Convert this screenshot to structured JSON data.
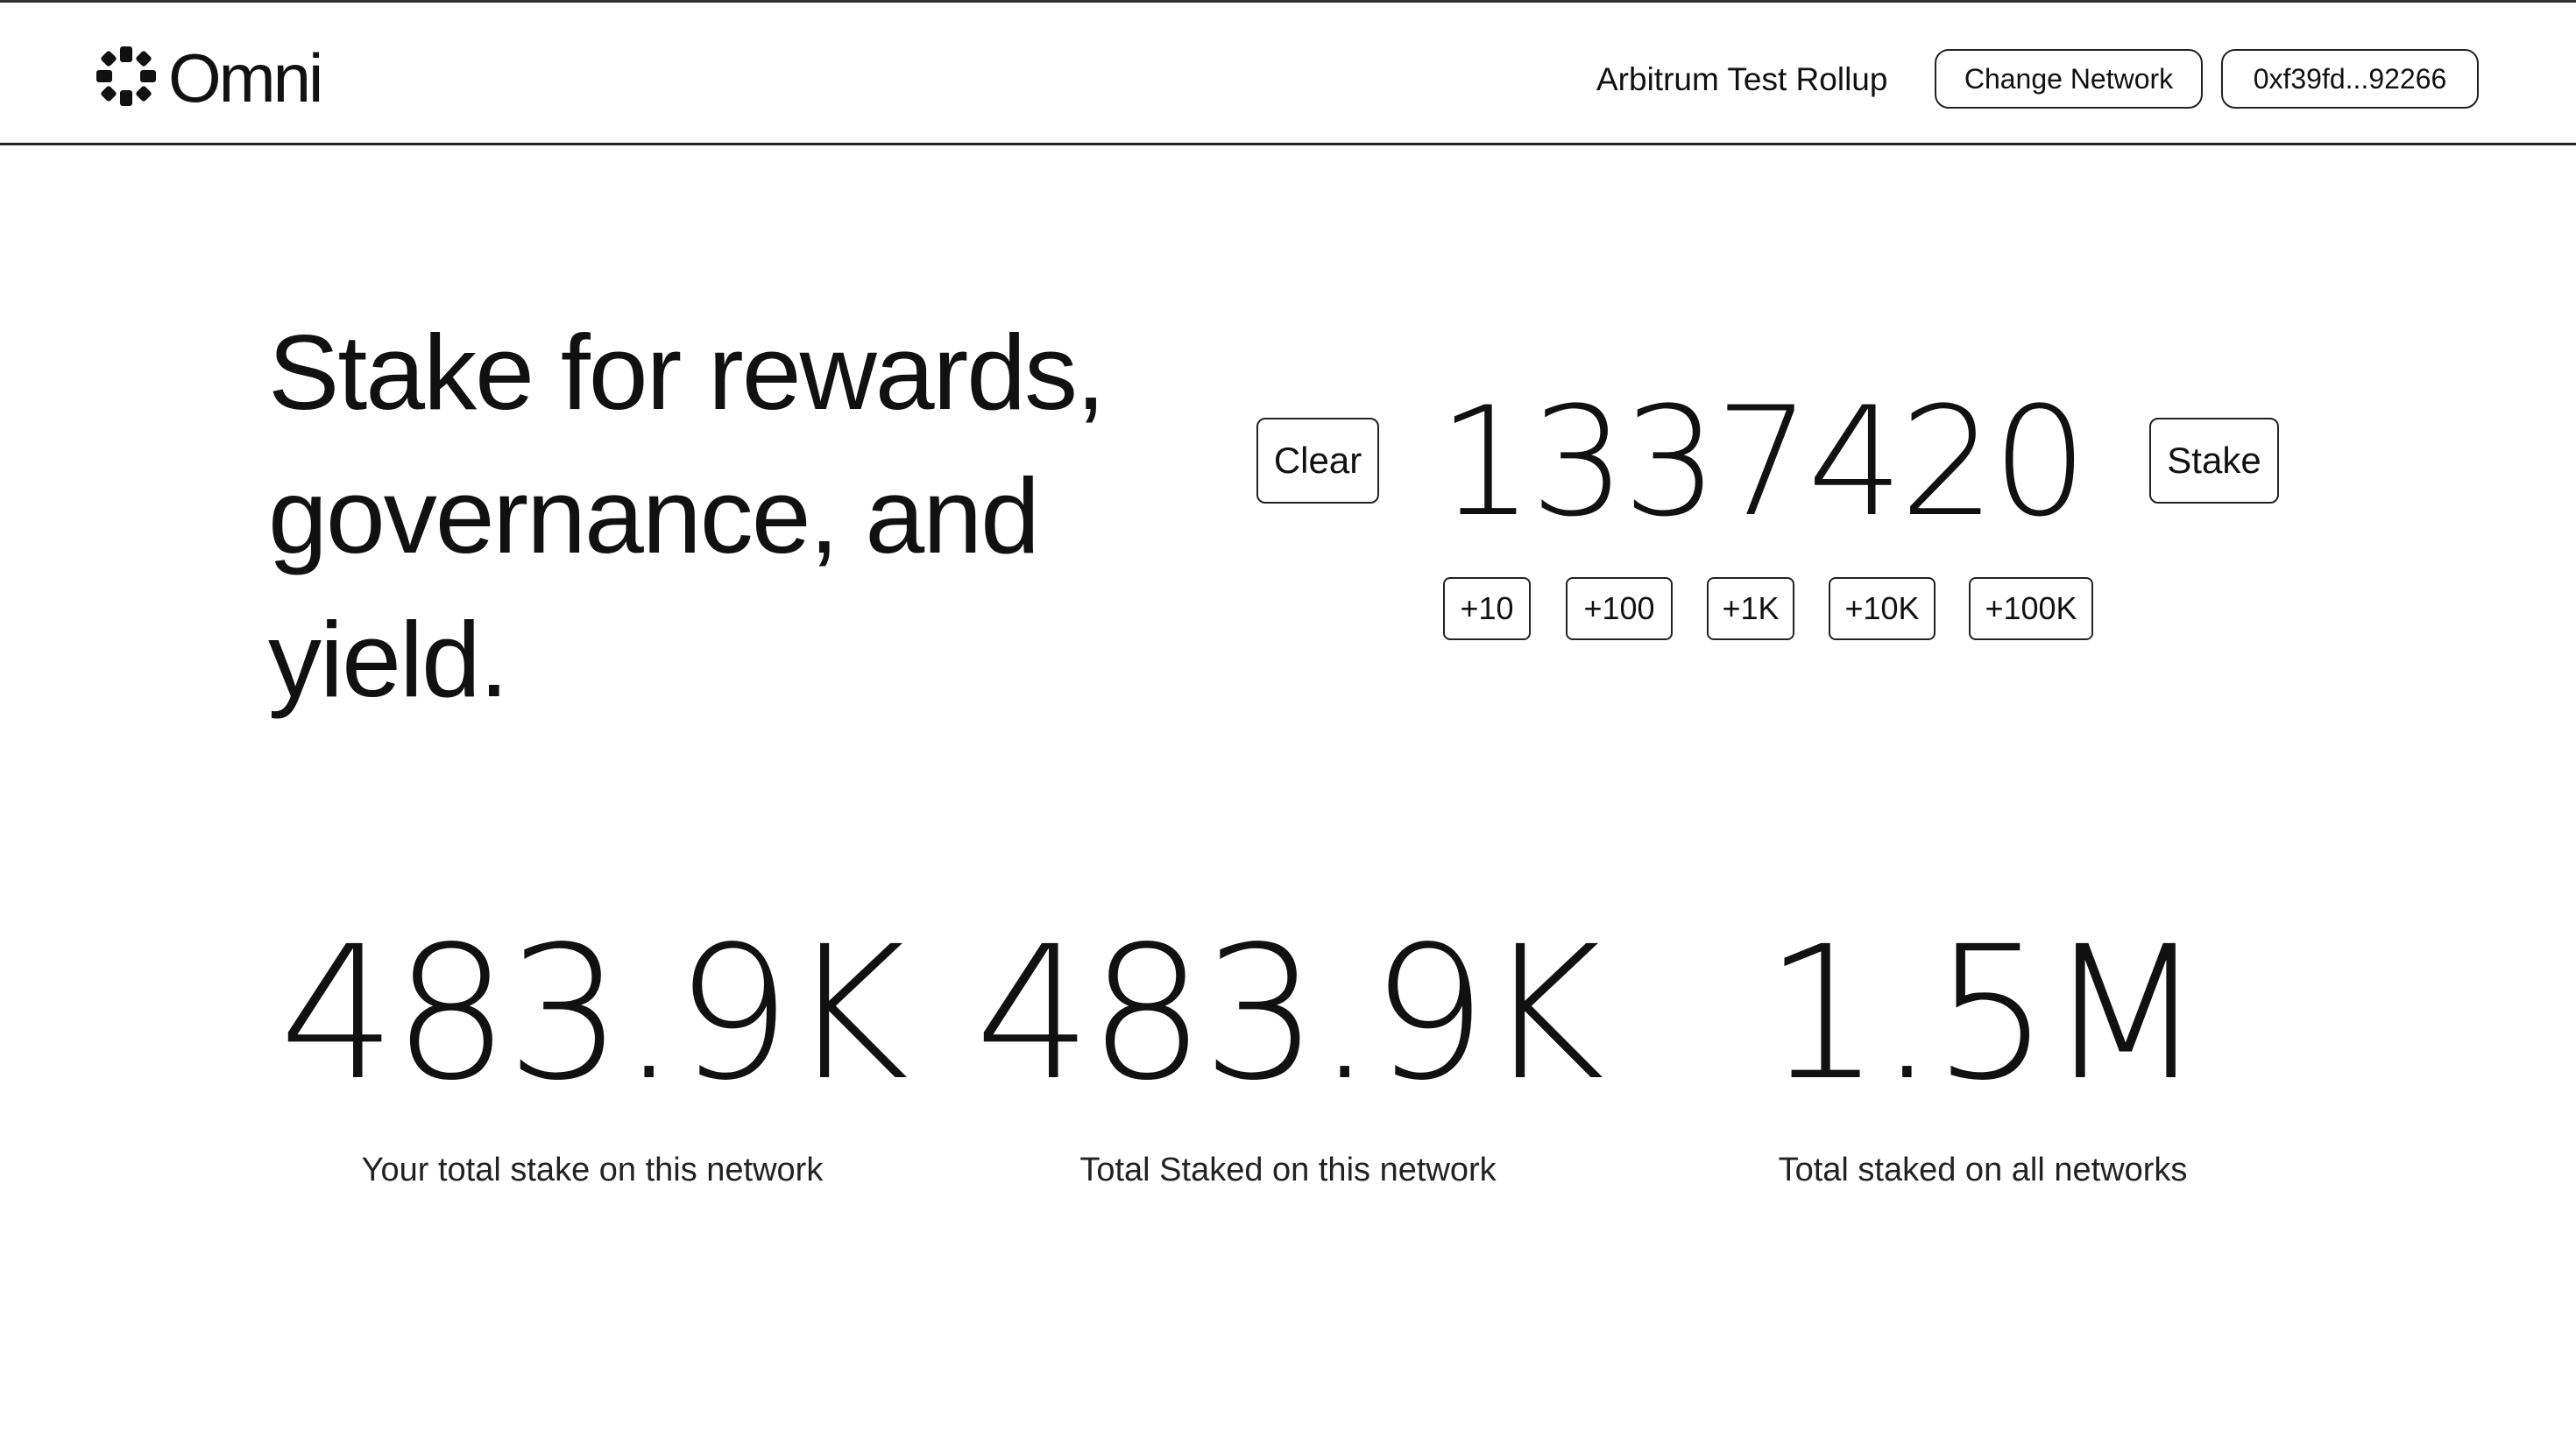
{
  "brand": {
    "name": "Omni",
    "logo_icon": "omni-flower-icon"
  },
  "header": {
    "network_name": "Arbitrum Test Rollup",
    "change_network_label": "Change Network",
    "wallet_address": "0xf39fd...92266"
  },
  "hero": {
    "title": "Stake for rewards, governance, and yield."
  },
  "stake": {
    "clear_label": "Clear",
    "amount": "1337420",
    "stake_label": "Stake",
    "increments": [
      "+10",
      "+100",
      "+1K",
      "+10K",
      "+100K"
    ]
  },
  "stats": [
    {
      "value": "483.9K",
      "label": "Your total stake on this network"
    },
    {
      "value": "483.9K",
      "label": "Total Staked on this network"
    },
    {
      "value": "1.5M",
      "label": "Total staked on all networks"
    }
  ]
}
